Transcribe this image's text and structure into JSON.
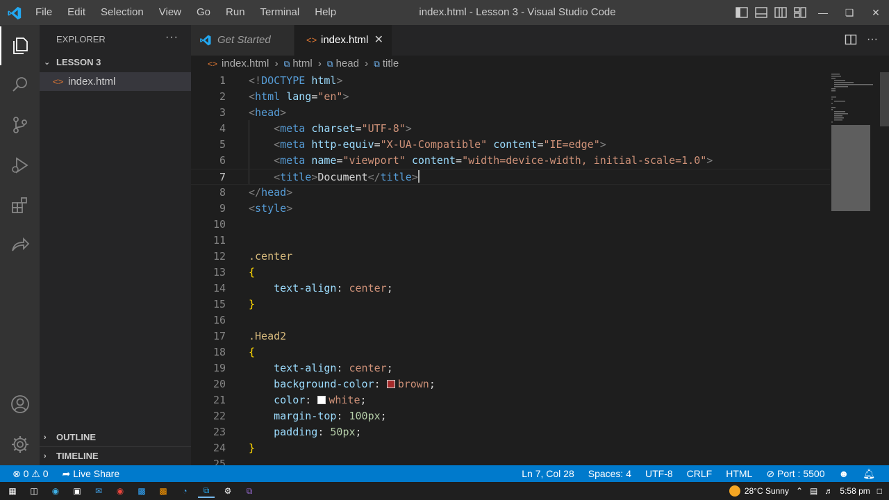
{
  "titlebar": {
    "menu": [
      "File",
      "Edit",
      "Selection",
      "View",
      "Go",
      "Run",
      "Terminal",
      "Help"
    ],
    "title": "index.html - Lesson 3 - Visual Studio Code"
  },
  "sidebar": {
    "header": "EXPLORER",
    "folder": "LESSON 3",
    "file": "index.html",
    "outline": "OUTLINE",
    "timeline": "TIMELINE"
  },
  "tabs": {
    "get_started": "Get Started",
    "active": "index.html"
  },
  "breadcrumb": [
    "index.html",
    "html",
    "head",
    "title"
  ],
  "editor": {
    "current_line": 7,
    "line_numbers": [
      "1",
      "2",
      "3",
      "4",
      "5",
      "6",
      "7",
      "8",
      "9",
      "10",
      "11",
      "12",
      "13",
      "14",
      "15",
      "16",
      "17",
      "18",
      "19",
      "20",
      "21",
      "22",
      "23",
      "24",
      "25"
    ]
  },
  "statusbar": {
    "errors": "0",
    "warnings": "0",
    "live_share": "Live Share",
    "position": "Ln 7, Col 28",
    "spaces": "Spaces: 4",
    "encoding": "UTF-8",
    "eol": "CRLF",
    "language": "HTML",
    "port": "Port : 5500"
  },
  "taskbar": {
    "weather": "28°C  Sunny",
    "time": "5:58 pm"
  },
  "colors": {
    "accent": "#007acc",
    "swatch_brown": "#a52a2a",
    "swatch_white": "#ffffff"
  }
}
